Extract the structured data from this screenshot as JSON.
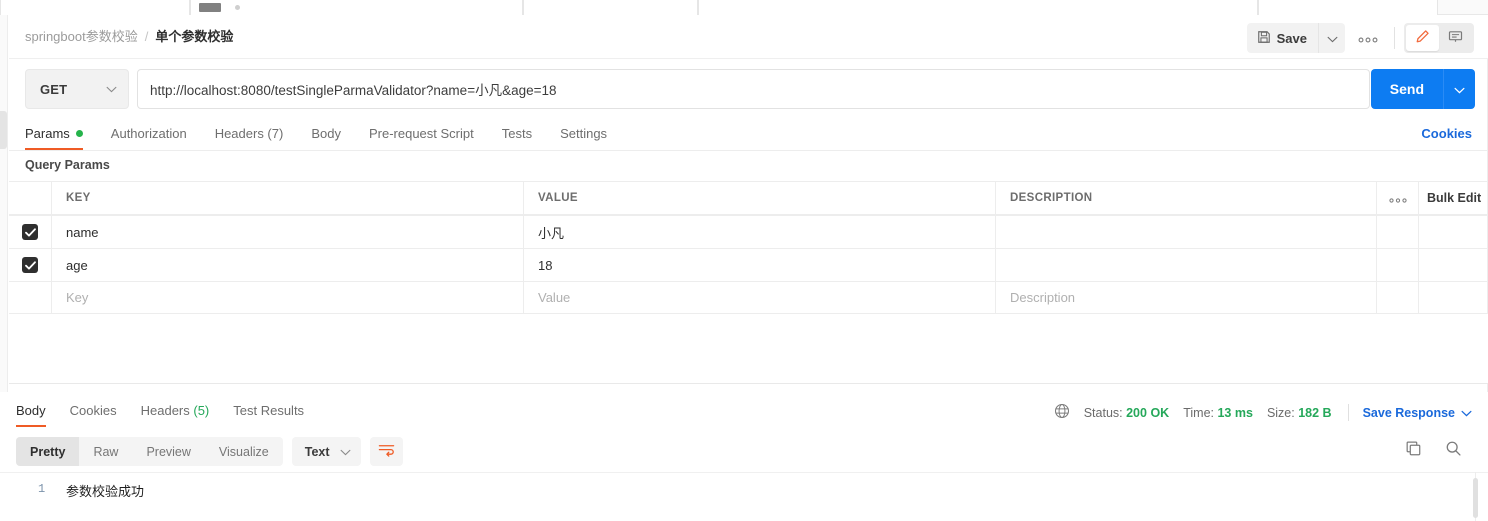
{
  "window": {
    "tabstrip_visible": true
  },
  "header": {
    "breadcrumb_root": "springboot参数校验",
    "breadcrumb_separator": "/",
    "breadcrumb_leaf": "单个参数校验",
    "save_label": "Save",
    "save_icon": "floppy-disk-icon",
    "save_caret_icon": "chevron-down-icon",
    "more_icon": "ellipsis-icon",
    "edit_icon": "pencil-icon",
    "comment_icon": "comment-icon",
    "accent_orange": "#ef5b25"
  },
  "request": {
    "method": "GET",
    "method_caret_icon": "chevron-down-icon",
    "url": "http://localhost:8080/testSingleParmaValidator?name=小凡&age=18",
    "send_label": "Send",
    "send_caret_icon": "chevron-down-icon",
    "send_color": "#0d7cf2",
    "tabs": [
      {
        "label": "Params",
        "active": true,
        "dot": true
      },
      {
        "label": "Authorization",
        "active": false,
        "dot": false
      },
      {
        "label": "Headers (7)",
        "active": false,
        "dot": false
      },
      {
        "label": "Body",
        "active": false,
        "dot": false
      },
      {
        "label": "Pre-request Script",
        "active": false,
        "dot": false
      },
      {
        "label": "Tests",
        "active": false,
        "dot": false
      },
      {
        "label": "Settings",
        "active": false,
        "dot": false
      }
    ],
    "cookies_link": "Cookies"
  },
  "params": {
    "section_title": "Query Params",
    "columns": {
      "key": "KEY",
      "value": "VALUE",
      "description": "DESCRIPTION"
    },
    "options_icon": "ellipsis-icon",
    "bulk_edit_label": "Bulk Edit",
    "rows": [
      {
        "checked": true,
        "key": "name",
        "value": "小凡",
        "description": ""
      },
      {
        "checked": true,
        "key": "age",
        "value": "18",
        "description": ""
      }
    ],
    "placeholder_row": {
      "key": "Key",
      "value": "Value",
      "description": "Description"
    }
  },
  "response": {
    "tabs": [
      {
        "label": "Body",
        "count": "",
        "active": true
      },
      {
        "label": "Cookies",
        "count": "",
        "active": false
      },
      {
        "label": "Headers ",
        "count": "(5)",
        "active": false
      },
      {
        "label": "Test Results",
        "count": "",
        "active": false
      }
    ],
    "globe_icon": "globe-icon",
    "status_label": "Status:",
    "status_value": "200 OK",
    "time_label": "Time:",
    "time_value": "13 ms",
    "size_label": "Size:",
    "size_value": "182 B",
    "save_response_label": "Save Response",
    "save_response_caret_icon": "chevron-down-icon",
    "status_color": "#25a85a",
    "format_buttons": [
      {
        "label": "Pretty",
        "selected": true
      },
      {
        "label": "Raw",
        "selected": false
      },
      {
        "label": "Preview",
        "selected": false
      },
      {
        "label": "Visualize",
        "selected": false
      }
    ],
    "content_type": "Text",
    "content_type_caret_icon": "chevron-down-icon",
    "wrap_icon": "word-wrap-icon",
    "copy_icon": "copy-icon",
    "search_icon": "search-icon",
    "body_lines": [
      {
        "number": "1",
        "text": "参数校验成功"
      }
    ]
  }
}
